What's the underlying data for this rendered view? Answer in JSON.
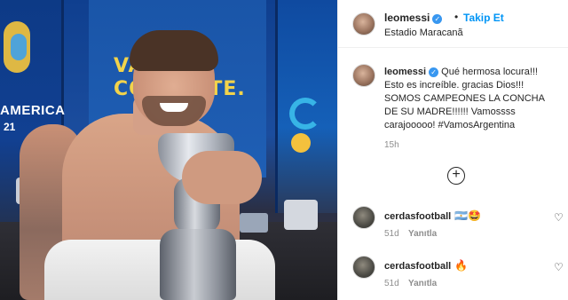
{
  "photo": {
    "banner_line1": "VAMOS",
    "banner_line2": "CONCRETE.",
    "side_text": "AMERICA",
    "side_year": "21"
  },
  "post_header": {
    "username": "leomessi",
    "separator": "•",
    "follow_label": "Takip Et",
    "location": "Estadio Maracanã"
  },
  "caption": {
    "username": "leomessi",
    "text": "Qué hermosa locura!!! Esto es increíble. gracias Dios!!! SOMOS CAMPEONES LA CONCHA DE SU MADRE!!!!!! Vamossss carajooooo! #VamosArgentina",
    "time": "15h"
  },
  "more_comments_icon": "plus-circle-icon",
  "comments": [
    {
      "username": "cerdasfootball",
      "text": "🇦🇷🤩",
      "time": "51d",
      "reply_label": "Yanıtla"
    },
    {
      "username": "cerdasfootball",
      "text": "🔥",
      "time": "51d",
      "reply_label": "Yanıtla"
    }
  ],
  "colors": {
    "follow_blue": "#0095f6",
    "verified_blue": "#3897f0",
    "muted_text": "#8e8e8e"
  }
}
